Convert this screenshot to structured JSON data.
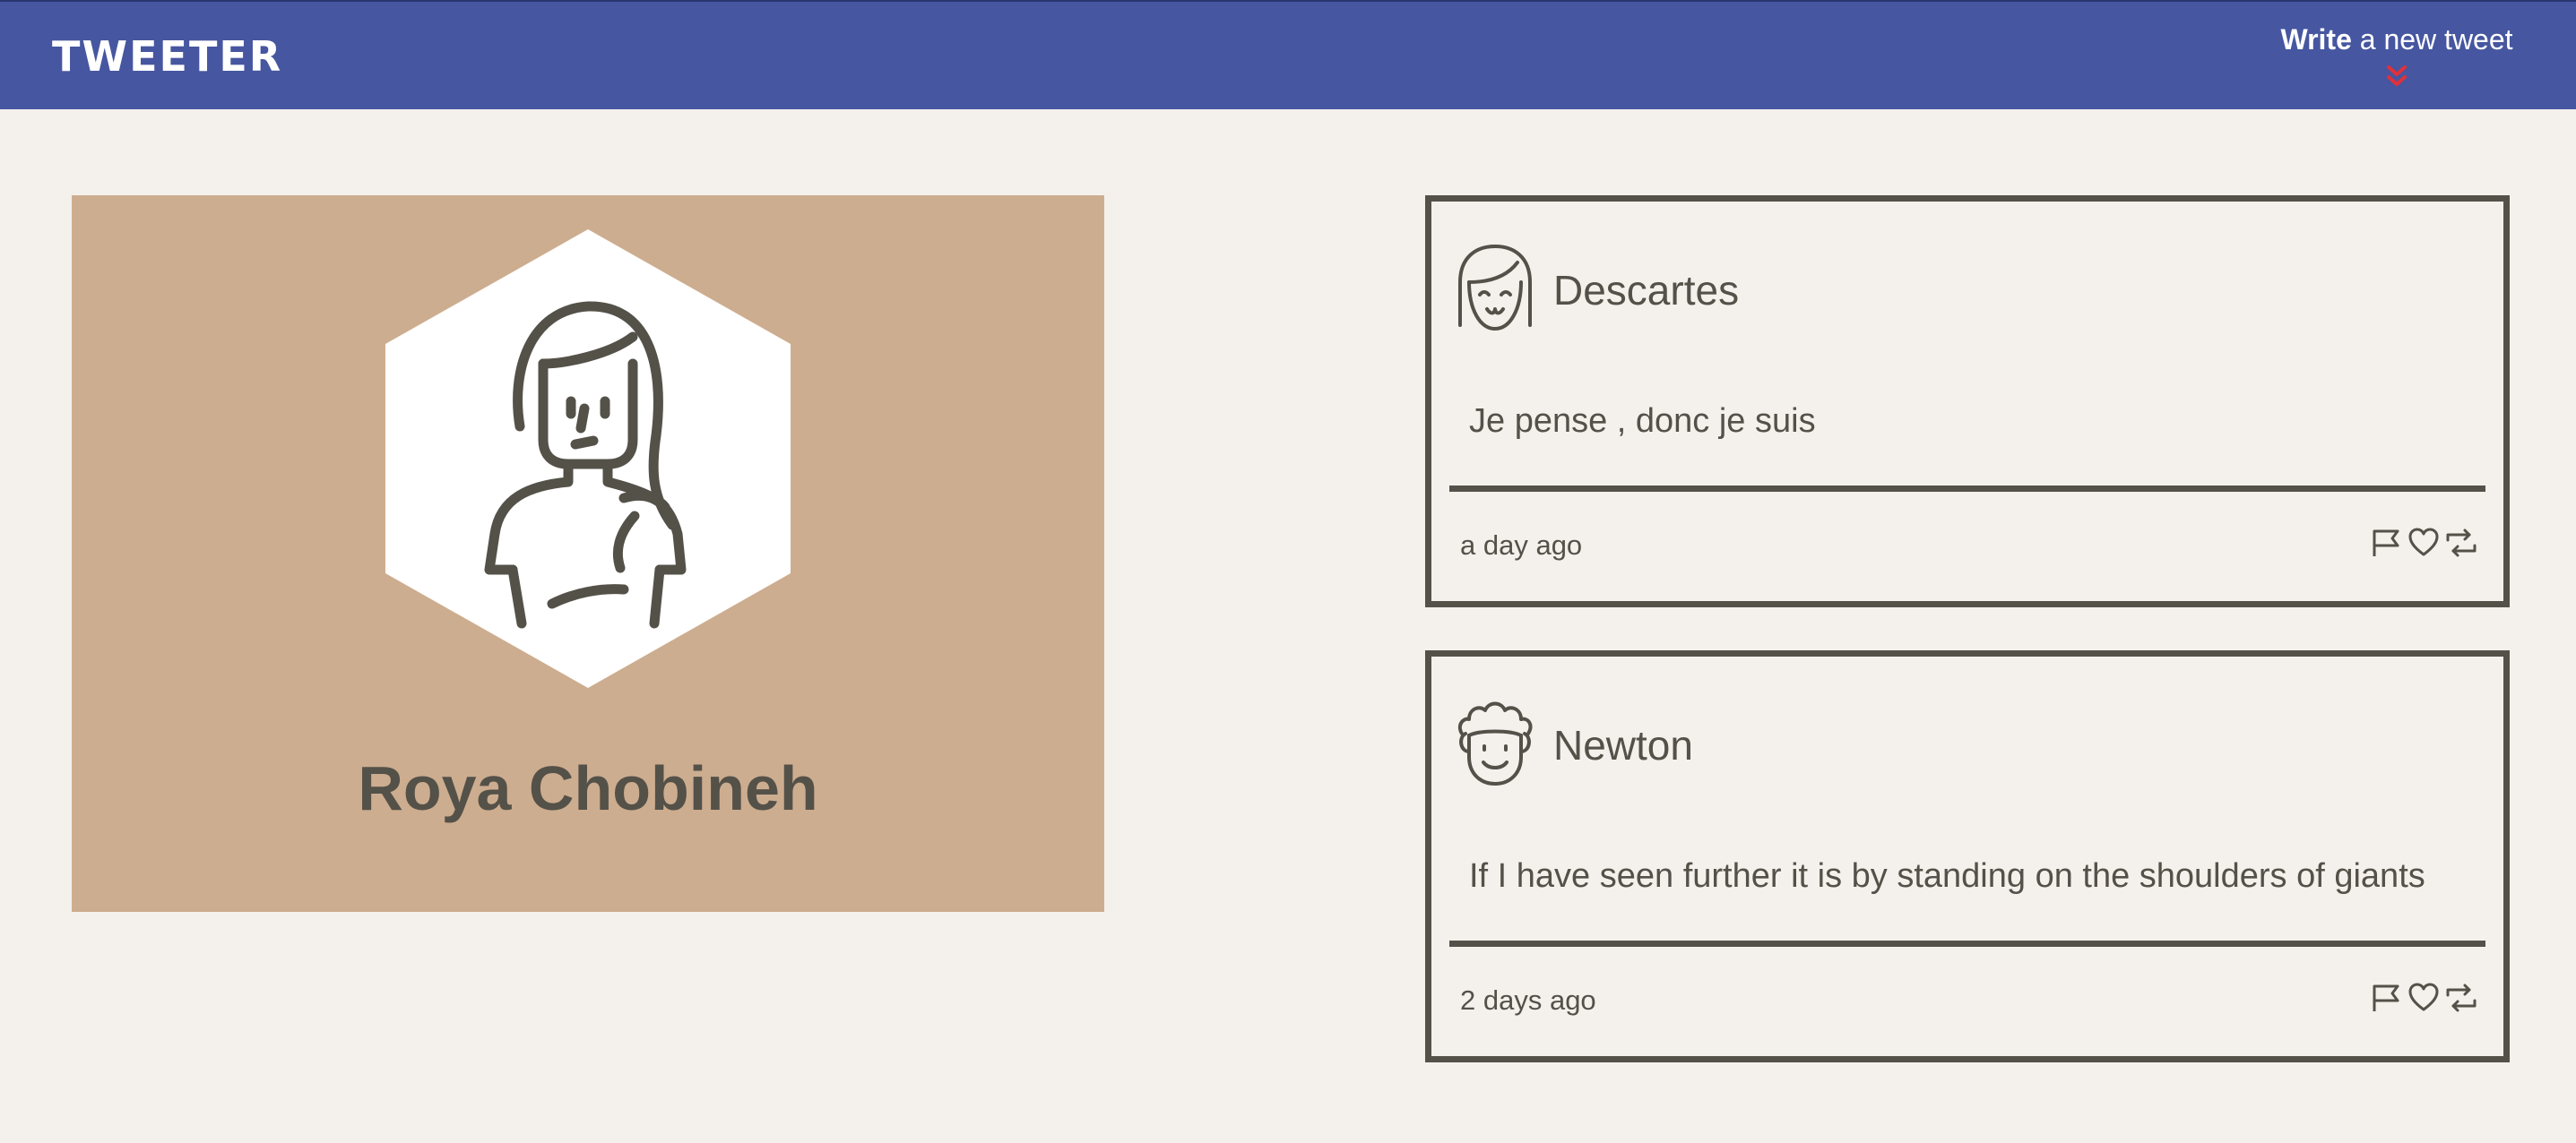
{
  "nav": {
    "logo": "TWEETER",
    "compose_bold": "Write",
    "compose_rest": " a new tweet",
    "chevron_icon": "double-chevron-down-icon",
    "accent_color": "#e0303a"
  },
  "profile": {
    "name": "Roya Chobineh",
    "avatar_icon": "woman-avatar-icon"
  },
  "tweets": [
    {
      "author": "Descartes",
      "avatar_icon": "girl-avatar-icon",
      "content": "Je pense , donc je suis",
      "time": "a day ago"
    },
    {
      "author": "Newton",
      "avatar_icon": "curly-hair-avatar-icon",
      "content": "If I have seen further it is by standing on the shoulders of giants",
      "time": "2 days ago"
    }
  ],
  "action_icons": [
    "flag-icon",
    "heart-icon",
    "retweet-icon"
  ],
  "colors": {
    "navbar": "#4656a0",
    "background": "#f4f1ec",
    "profile_card": "#cdad8f",
    "ink": "#545149"
  }
}
